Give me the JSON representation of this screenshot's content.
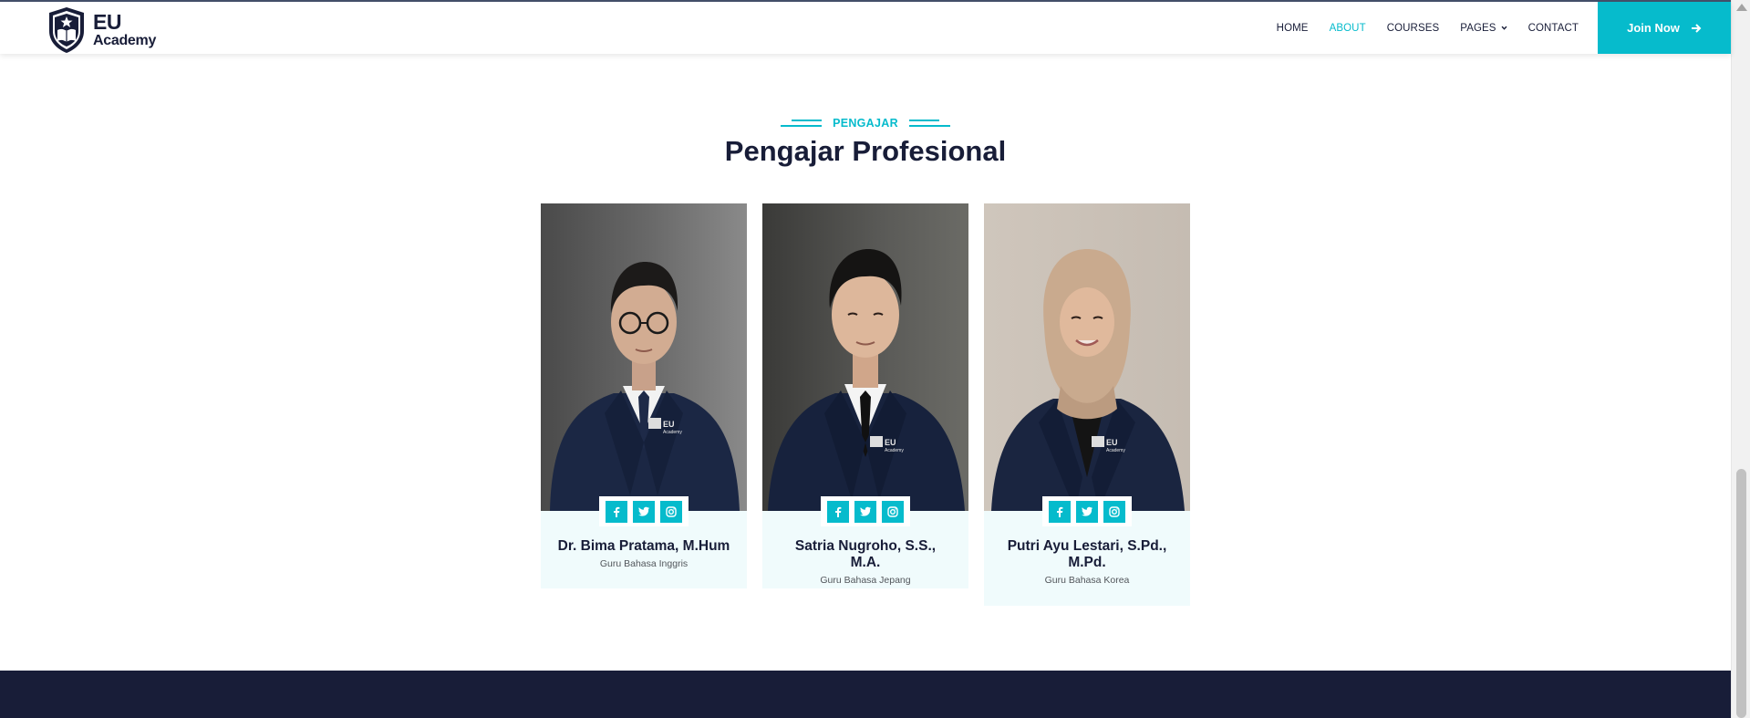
{
  "brand": {
    "name_line1": "EU",
    "name_line2": "Academy"
  },
  "nav": {
    "items": [
      {
        "label": "HOME",
        "active": false
      },
      {
        "label": "ABOUT",
        "active": true
      },
      {
        "label": "COURSES",
        "active": false
      },
      {
        "label": "PAGES",
        "active": false,
        "dropdown": true
      },
      {
        "label": "CONTACT",
        "active": false
      }
    ],
    "cta_label": "Join Now"
  },
  "section": {
    "subtitle": "PENGAJAR",
    "title": "Pengajar Profesional"
  },
  "team": [
    {
      "name": "Dr. Bima Pratama, M.Hum",
      "role": "Guru Bahasa Inggris"
    },
    {
      "name": "Satria Nugroho, S.S., M.A.",
      "role": "Guru Bahasa Jepang"
    },
    {
      "name": "Putri Ayu Lestari, S.Pd., M.Pd.",
      "role": "Guru Bahasa Korea"
    }
  ],
  "social_icons": [
    "facebook-icon",
    "twitter-icon",
    "instagram-icon"
  ],
  "colors": {
    "accent": "#06bbcc",
    "dark": "#181d38",
    "card_bg": "#f0fbfc"
  }
}
